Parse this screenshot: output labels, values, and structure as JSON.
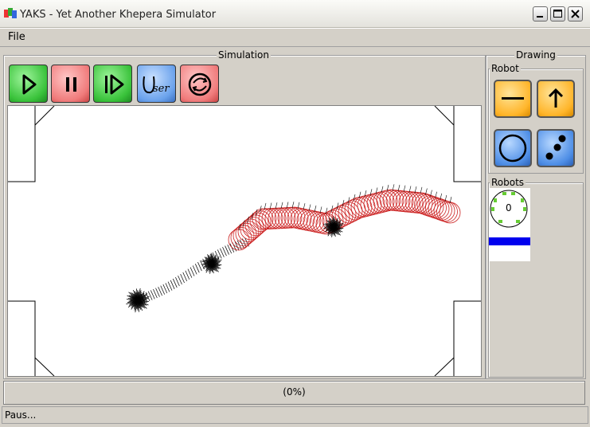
{
  "window": {
    "title": "YAKS - Yet Another Khepera Simulator"
  },
  "menu": {
    "file": "File"
  },
  "simulation": {
    "label": "Simulation",
    "toolbar": [
      "play",
      "pause",
      "step",
      "user",
      "reset"
    ],
    "user_button_label": "User"
  },
  "drawing": {
    "label": "Drawing",
    "robot_section": "Robot",
    "robots_section": "Robots",
    "robot_list": [
      {
        "id": "0"
      }
    ]
  },
  "progress": {
    "text": "(0%)"
  },
  "status": {
    "text": "Paus..."
  },
  "colors": {
    "trail_red": "#cc2222",
    "sensor_black": "#000000",
    "robot_green": "#66cc33",
    "selection_blue": "#0000ee"
  }
}
